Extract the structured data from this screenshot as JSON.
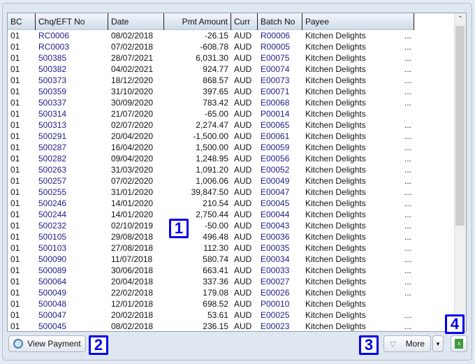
{
  "columns": [
    "BC",
    "Chq/EFT No",
    "Date",
    "Pmt Amount",
    "Curr",
    "Batch No",
    "Payee"
  ],
  "rows": [
    [
      "01",
      "RC0006",
      "08/02/2018",
      "-26.15",
      "AUD",
      "R00006",
      "Kitchen Delights",
      "..."
    ],
    [
      "01",
      "RC0003",
      "07/02/2018",
      "-608.78",
      "AUD",
      "R00005",
      "Kitchen Delights",
      "..."
    ],
    [
      "01",
      "500385",
      "28/07/2021",
      "6,031.30",
      "AUD",
      "E00075",
      "Kitchen Delights",
      "..."
    ],
    [
      "01",
      "500382",
      "04/02/2021",
      "924.77",
      "AUD",
      "E00074",
      "Kitchen Delights",
      "..."
    ],
    [
      "01",
      "500373",
      "18/12/2020",
      "868.57",
      "AUD",
      "E00073",
      "Kitchen Delights",
      "..."
    ],
    [
      "01",
      "500359",
      "31/10/2020",
      "397.65",
      "AUD",
      "E00071",
      "Kitchen Delights",
      "..."
    ],
    [
      "01",
      "500337",
      "30/09/2020",
      "783.42",
      "AUD",
      "E00068",
      "Kitchen Delights",
      "..."
    ],
    [
      "01",
      "500314",
      "21/07/2020",
      "-65.00",
      "AUD",
      "P00014",
      "Kitchen Delights",
      ""
    ],
    [
      "01",
      "500313",
      "02/07/2020",
      "2,274.47",
      "AUD",
      "E00065",
      "Kitchen Delights",
      "..."
    ],
    [
      "01",
      "500291",
      "20/04/2020",
      "-1,500.00",
      "AUD",
      "E00061",
      "Kitchen Delights",
      "..."
    ],
    [
      "01",
      "500287",
      "16/04/2020",
      "1,500.00",
      "AUD",
      "E00059",
      "Kitchen Delights",
      "..."
    ],
    [
      "01",
      "500282",
      "09/04/2020",
      "1,248.95",
      "AUD",
      "E00056",
      "Kitchen Delights",
      "..."
    ],
    [
      "01",
      "500263",
      "31/03/2020",
      "1,091.20",
      "AUD",
      "E00052",
      "Kitchen Delights",
      "..."
    ],
    [
      "01",
      "500257",
      "07/02/2020",
      "1,006.06",
      "AUD",
      "E00049",
      "Kitchen Delights",
      "..."
    ],
    [
      "01",
      "500255",
      "31/01/2020",
      "39,847.50",
      "AUD",
      "E00047",
      "Kitchen Delights",
      "..."
    ],
    [
      "01",
      "500246",
      "14/01/2020",
      "210.54",
      "AUD",
      "E00045",
      "Kitchen Delights",
      "..."
    ],
    [
      "01",
      "500244",
      "14/01/2020",
      "2,750.44",
      "AUD",
      "E00044",
      "Kitchen Delights",
      "..."
    ],
    [
      "01",
      "500232",
      "02/10/2019",
      "-50.00",
      "AUD",
      "E00043",
      "Kitchen Delights",
      "..."
    ],
    [
      "01",
      "500105",
      "29/08/2018",
      "496.48",
      "AUD",
      "E00036",
      "Kitchen Delights",
      "..."
    ],
    [
      "01",
      "500103",
      "27/08/2018",
      "112.30",
      "AUD",
      "E00035",
      "Kitchen Delights",
      "..."
    ],
    [
      "01",
      "500090",
      "11/07/2018",
      "580.74",
      "AUD",
      "E00034",
      "Kitchen Delights",
      "..."
    ],
    [
      "01",
      "500089",
      "30/06/2018",
      "663.41",
      "AUD",
      "E00033",
      "Kitchen Delights",
      "..."
    ],
    [
      "01",
      "500064",
      "20/04/2018",
      "337.36",
      "AUD",
      "E00027",
      "Kitchen Delights",
      "..."
    ],
    [
      "01",
      "500049",
      "22/02/2018",
      "179.08",
      "AUD",
      "E00026",
      "Kitchen Delights",
      "..."
    ],
    [
      "01",
      "500048",
      "12/01/2018",
      "698.52",
      "AUD",
      "P00010",
      "Kitchen Delights",
      ""
    ],
    [
      "01",
      "500047",
      "20/02/2018",
      "53.61",
      "AUD",
      "E00025",
      "Kitchen Delights",
      "..."
    ],
    [
      "01",
      "500045",
      "08/02/2018",
      "236.15",
      "AUD",
      "E00023",
      "Kitchen Delights",
      "..."
    ]
  ],
  "buttons": {
    "view_payment": "View Payment",
    "more": "More"
  },
  "scroll_position": 0,
  "markers": [
    "1",
    "2",
    "3",
    "4"
  ]
}
